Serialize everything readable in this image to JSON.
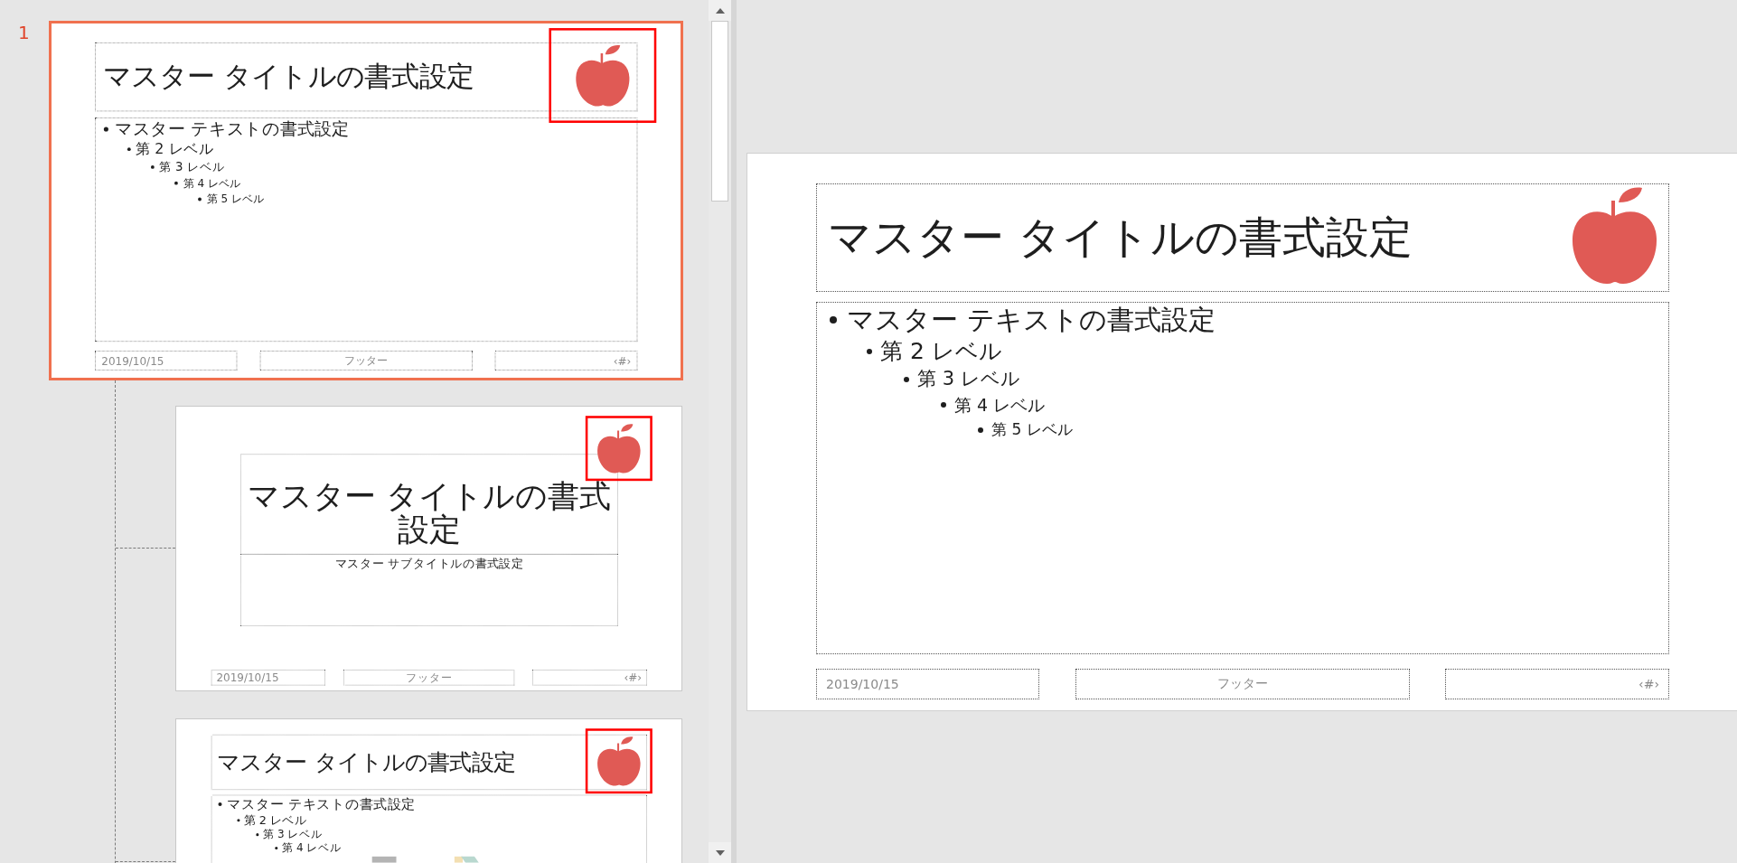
{
  "thumbnail_pane": {
    "slides": [
      {
        "number": "1",
        "selected": true,
        "logo_highlighted": true,
        "slide": {
          "kind": "title_and_content",
          "title": "マスター タイトルの書式設定",
          "body": [
            {
              "text": "マスター テキストの書式設定",
              "children": [
                {
                  "text": "第 2 レベル",
                  "children": [
                    {
                      "text": "第 3 レベル",
                      "children": [
                        {
                          "text": "第 4 レベル",
                          "children": [
                            {
                              "text": "第 5 レベル"
                            }
                          ]
                        }
                      ]
                    }
                  ]
                }
              ]
            }
          ],
          "date": "2019/10/15",
          "footer": "フッター",
          "page_number": "‹#›"
        },
        "children": [
          {
            "selected": false,
            "logo_highlighted": true,
            "slide": {
              "kind": "title_slide",
              "title": "マスター タイトルの書式設定",
              "subtitle": "マスター サブタイトルの書式設定",
              "date": "2019/10/15",
              "footer": "フッター",
              "page_number": "‹#›"
            }
          },
          {
            "selected": false,
            "logo_highlighted": true,
            "slide": {
              "kind": "title_content_graphic",
              "title": "マスター タイトルの書式設定",
              "body": [
                {
                  "text": "マスター テキストの書式設定",
                  "children": [
                    {
                      "text": "第 2 レベル",
                      "children": [
                        {
                          "text": "第 3 レベル",
                          "children": [
                            {
                              "text": "第 4 レベル"
                            }
                          ]
                        }
                      ]
                    }
                  ]
                }
              ]
            }
          }
        ]
      }
    ]
  },
  "main_slide": {
    "kind": "title_and_content",
    "title": "マスター タイトルの書式設定",
    "body": [
      {
        "text": "マスター テキストの書式設定",
        "children": [
          {
            "text": "第 2 レベル",
            "children": [
              {
                "text": "第 3 レベル",
                "children": [
                  {
                    "text": "第 4 レベル",
                    "children": [
                      {
                        "text": "第 5 レベル"
                      }
                    ]
                  }
                ]
              }
            ]
          }
        ]
      }
    ],
    "date": "2019/10/15",
    "footer": "フッター",
    "page_number": "‹#›"
  }
}
